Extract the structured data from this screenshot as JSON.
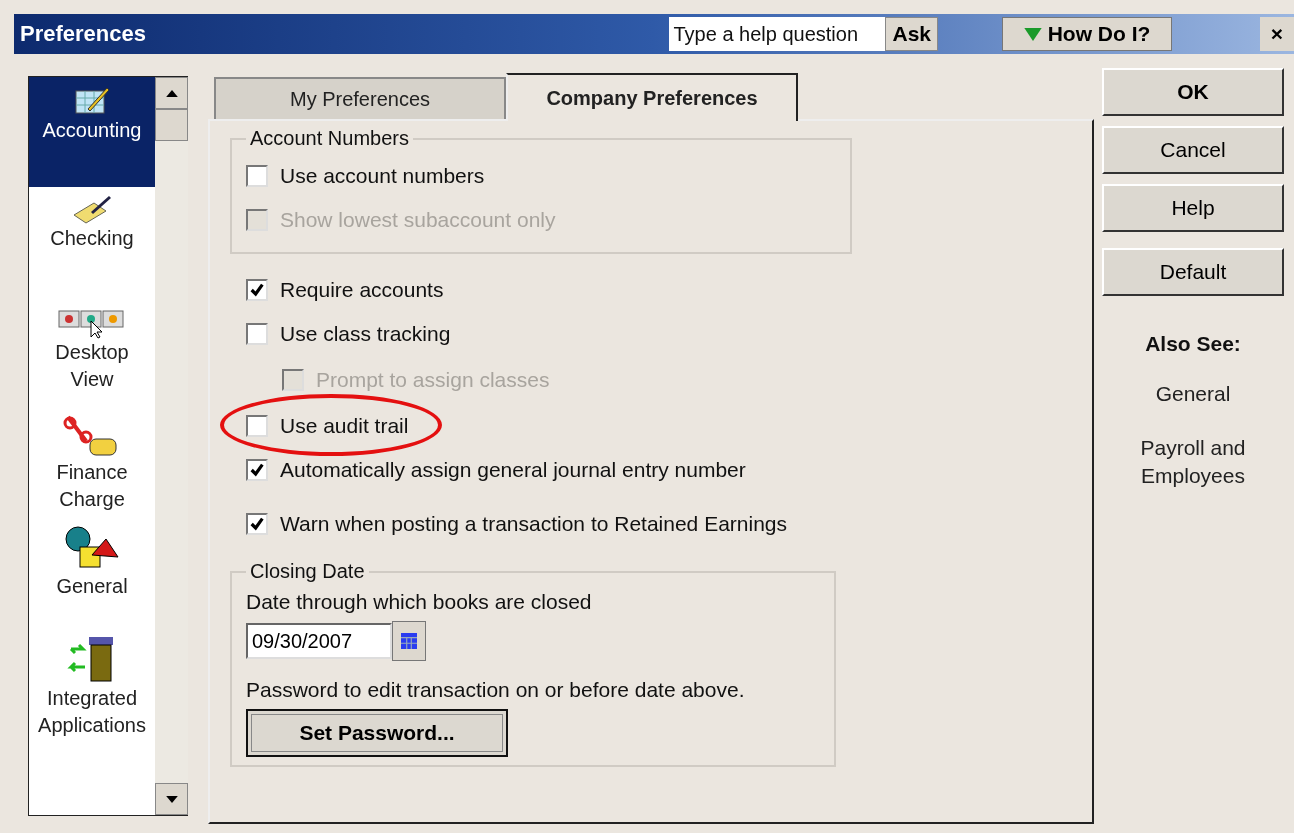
{
  "window": {
    "title": "Preferences",
    "help_field": {
      "placeholder": "Type a help question"
    },
    "ask_button": "Ask",
    "how_do_i_button": "How Do I?",
    "close_button": "×"
  },
  "sidebar": {
    "items": [
      {
        "label": "Accounting",
        "selected": true
      },
      {
        "label": "Checking",
        "selected": false
      },
      {
        "label": "Desktop View",
        "selected": false
      },
      {
        "label": "Finance Charge",
        "selected": false
      },
      {
        "label": "General",
        "selected": false
      },
      {
        "label": "Integrated Applications",
        "selected": false
      }
    ]
  },
  "tabs": [
    {
      "label": "My Preferences",
      "selected": false
    },
    {
      "label": "Company Preferences",
      "selected": true
    }
  ],
  "account_numbers": {
    "title": "Account Numbers",
    "options": [
      {
        "label": "Use account numbers",
        "checked": false,
        "disabled": false
      },
      {
        "label": "Show lowest subaccount only",
        "checked": false,
        "disabled": true
      }
    ]
  },
  "options": [
    {
      "label": "Require accounts",
      "checked": true,
      "disabled": false,
      "highlighted": false
    },
    {
      "label": "Use class tracking",
      "checked": false,
      "disabled": false,
      "highlighted": false,
      "children": [
        {
          "label": "Prompt to assign classes",
          "checked": false,
          "disabled": true,
          "highlighted": false
        }
      ]
    },
    {
      "label": "Use audit trail",
      "checked": false,
      "disabled": false,
      "highlighted": true
    },
    {
      "label": "Automatically assign general journal entry number",
      "checked": true,
      "disabled": false,
      "highlighted": false
    },
    {
      "label": "Warn when posting a transaction to Retained Earnings",
      "checked": true,
      "disabled": false,
      "highlighted": false
    }
  ],
  "closing_date": {
    "title": "Closing Date",
    "date_label": "Date through which books are closed",
    "date_value": "09/30/2007",
    "password_label": "Password to edit transaction on or before date above.",
    "password_button": "Set Password..."
  },
  "buttons": [
    "OK",
    "Cancel",
    "Help",
    "Default"
  ],
  "also_see": {
    "title": "Also See:",
    "links": [
      "General",
      "Payroll and Employees"
    ]
  }
}
